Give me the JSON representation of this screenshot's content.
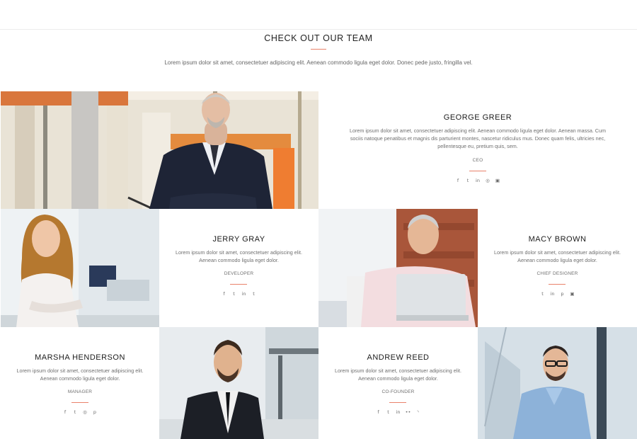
{
  "section": {
    "title": "CHECK OUT OUR TEAM",
    "subtitle": "Lorem ipsum dolor sit amet, consectetuer adipiscing elit. Aenean commodo ligula eget dolor. Donec pede justo, fringilla vel."
  },
  "members": [
    {
      "name": "GEORGE GREER",
      "description": "Lorem ipsum dolor sit amet, consectetuer adipiscing elit. Aenean commodo ligula eget dolor. Aenean massa. Cum sociis natoque penatibus et magnis dis parturient montes, nascetur ridiculus mus. Donec quam felis, ultricies nec, pellentesque eu, pretium quis, sem.",
      "role": "CEO",
      "socials": [
        "facebook-icon",
        "twitter-icon",
        "linkedin-icon",
        "dribbble-icon",
        "instagram-icon"
      ],
      "social_glyphs": [
        "f",
        "t",
        "in",
        "◎",
        "▣"
      ]
    },
    {
      "name": "JERRY GRAY",
      "description": "Lorem ipsum dolor sit amet, consectetuer adipiscing elit. Aenean commodo ligula eget dolor.",
      "role": "DEVELOPER",
      "socials": [
        "facebook-icon",
        "twitter-icon",
        "linkedin-icon",
        "tumblr-icon"
      ],
      "social_glyphs": [
        "f",
        "t",
        "in",
        "t"
      ]
    },
    {
      "name": "MACY BROWN",
      "description": "Lorem ipsum dolor sit amet, consectetuer adipiscing elit. Aenean commodo ligula eget dolor.",
      "role": "CHIEF DESIGNER",
      "socials": [
        "twitter-icon",
        "linkedin-icon",
        "pinterest-icon",
        "instagram-icon"
      ],
      "social_glyphs": [
        "t",
        "in",
        "p",
        "▣"
      ]
    },
    {
      "name": "MARSHA HENDERSON",
      "description": "Lorem ipsum dolor sit amet, consectetuer adipiscing elit. Aenean commodo ligula eget dolor.",
      "role": "MANAGER",
      "socials": [
        "facebook-icon",
        "twitter-icon",
        "dribbble-icon",
        "pinterest-icon"
      ],
      "social_glyphs": [
        "f",
        "t",
        "◎",
        "p"
      ]
    },
    {
      "name": "ANDREW REED",
      "description": "Lorem ipsum dolor sit amet, consectetuer adipiscing elit. Aenean commodo ligula eget dolor.",
      "role": "CO-FOUNDER",
      "socials": [
        "facebook-icon",
        "twitter-icon",
        "linkedin-icon",
        "flickr-icon",
        "rss-icon"
      ],
      "social_glyphs": [
        "f",
        "t",
        "in",
        "••",
        "◝"
      ]
    }
  ],
  "colors": {
    "accent": "#e9826b",
    "text": "#1b1b1b",
    "muted": "#6f6f6f"
  }
}
